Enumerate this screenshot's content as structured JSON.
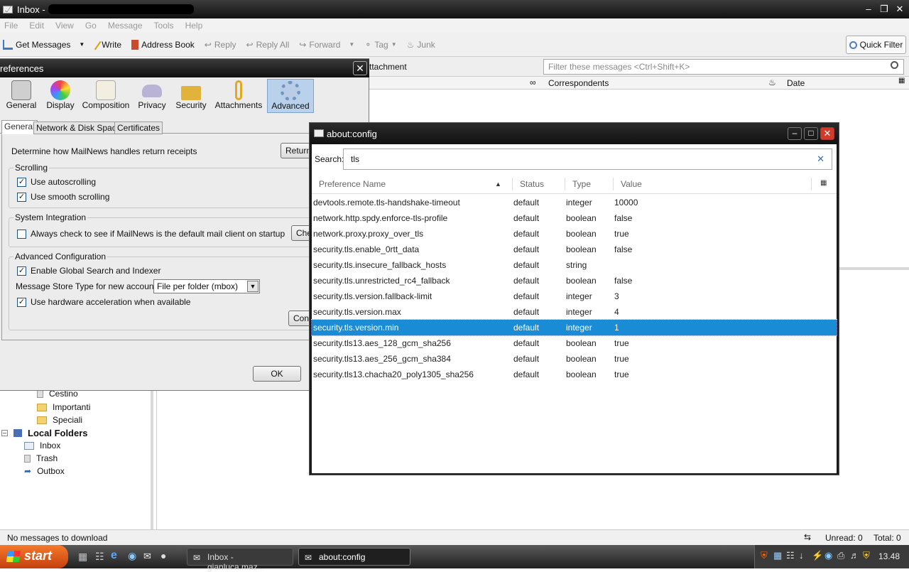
{
  "main": {
    "title": "Inbox -",
    "menu": [
      "File",
      "Edit",
      "View",
      "Go",
      "Message",
      "Tools",
      "Help"
    ],
    "toolbar": {
      "get_messages": "Get Messages",
      "write": "Write",
      "address_book": "Address Book",
      "reply": "Reply",
      "reply_all": "Reply All",
      "forward": "Forward",
      "tag": "Tag",
      "junk": "Junk",
      "quick_filter": "Quick Filter"
    },
    "filter_placeholder": "Filter these messages <Ctrl+Shift+K>",
    "filter_label_fragment": "ttachment",
    "columns": {
      "correspondents": "Correspondents",
      "date": "Date"
    },
    "folders": {
      "cestino": "Cestino",
      "importanti": "Importanti",
      "speciali": "Speciali",
      "local_folders": "Local Folders",
      "inbox": "Inbox",
      "trash": "Trash",
      "outbox": "Outbox"
    },
    "status": {
      "left": "No messages to download",
      "unread": "Unread: 0",
      "total": "Total: 0"
    }
  },
  "prefs": {
    "title": "references",
    "panes": [
      "General",
      "Display",
      "Composition",
      "Privacy",
      "Security",
      "Attachments",
      "Advanced"
    ],
    "selected_pane": "Advanced",
    "tabs": [
      "General",
      "Network & Disk Space",
      "Certificates"
    ],
    "receipts_text": "Determine how MailNews handles return receipts",
    "return_button": "Return",
    "scrolling": {
      "label": "Scrolling",
      "autoscroll": "Use autoscrolling",
      "smooth": "Use smooth scrolling"
    },
    "system": {
      "label": "System Integration",
      "default_check": "Always check to see if MailNews is the default mail client on startup",
      "check_button": "Che"
    },
    "advanced": {
      "label": "Advanced Configuration",
      "global_search": "Enable Global Search and Indexer",
      "store_type_label": "Message Store Type for new accounts:",
      "store_type_value": "File per folder (mbox)",
      "hw_accel": "Use hardware acceleration when available",
      "config_button": "Confi"
    },
    "ok_button": "OK"
  },
  "about_config": {
    "title": "about:config",
    "search_label": "Search:",
    "search_value": "tls",
    "headers": {
      "name": "Preference Name",
      "status": "Status",
      "type": "Type",
      "value": "Value"
    },
    "rows": [
      {
        "name": "devtools.remote.tls-handshake-timeout",
        "status": "default",
        "type": "integer",
        "value": "10000"
      },
      {
        "name": "network.http.spdy.enforce-tls-profile",
        "status": "default",
        "type": "boolean",
        "value": "false"
      },
      {
        "name": "network.proxy.proxy_over_tls",
        "status": "default",
        "type": "boolean",
        "value": "true"
      },
      {
        "name": "security.tls.enable_0rtt_data",
        "status": "default",
        "type": "boolean",
        "value": "false"
      },
      {
        "name": "security.tls.insecure_fallback_hosts",
        "status": "default",
        "type": "string",
        "value": ""
      },
      {
        "name": "security.tls.unrestricted_rc4_fallback",
        "status": "default",
        "type": "boolean",
        "value": "false"
      },
      {
        "name": "security.tls.version.fallback-limit",
        "status": "default",
        "type": "integer",
        "value": "3"
      },
      {
        "name": "security.tls.version.max",
        "status": "default",
        "type": "integer",
        "value": "4"
      },
      {
        "name": "security.tls.version.min",
        "status": "default",
        "type": "integer",
        "value": "1"
      },
      {
        "name": "security.tls13.aes_128_gcm_sha256",
        "status": "default",
        "type": "boolean",
        "value": "true"
      },
      {
        "name": "security.tls13.aes_256_gcm_sha384",
        "status": "default",
        "type": "boolean",
        "value": "true"
      },
      {
        "name": "security.tls13.chacha20_poly1305_sha256",
        "status": "default",
        "type": "boolean",
        "value": "true"
      }
    ],
    "selected_row": 8
  },
  "taskbar": {
    "start": "start",
    "tasks": [
      "Inbox - gianluca.maz...",
      "about:config"
    ],
    "clock": "13.48"
  },
  "colors": {
    "selection": "#1a8bd5",
    "start_button": "#e0591c"
  }
}
